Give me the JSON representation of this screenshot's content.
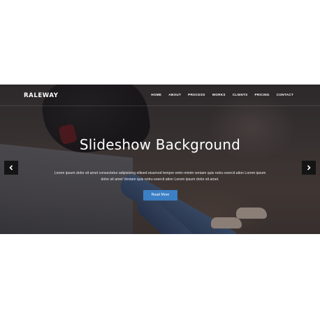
{
  "navbar": {
    "brand": "RALEWAY",
    "items": [
      "HOME",
      "ABOUT",
      "PROCESS",
      "WORKS",
      "CLIENTS",
      "PRICING",
      "CONTACT"
    ]
  },
  "hero": {
    "title": "Slideshow Background",
    "description": "Lorem ipsum dolor sit amet consectetur adipisicing elitsed eiusmod tempor enim minim veniam quis notru exercit ation Lorem ipsum dolor sit amet Veniam quis notru exercit ation Lorem ipsum dolor sit amet.",
    "button_label": "Read More"
  },
  "slider": {
    "prev_icon": "chevron-left-icon",
    "next_icon": "chevron-right-icon"
  },
  "colors": {
    "accent": "#3b7fc4",
    "arrow_bg": "#141414",
    "text": "#ffffff"
  }
}
